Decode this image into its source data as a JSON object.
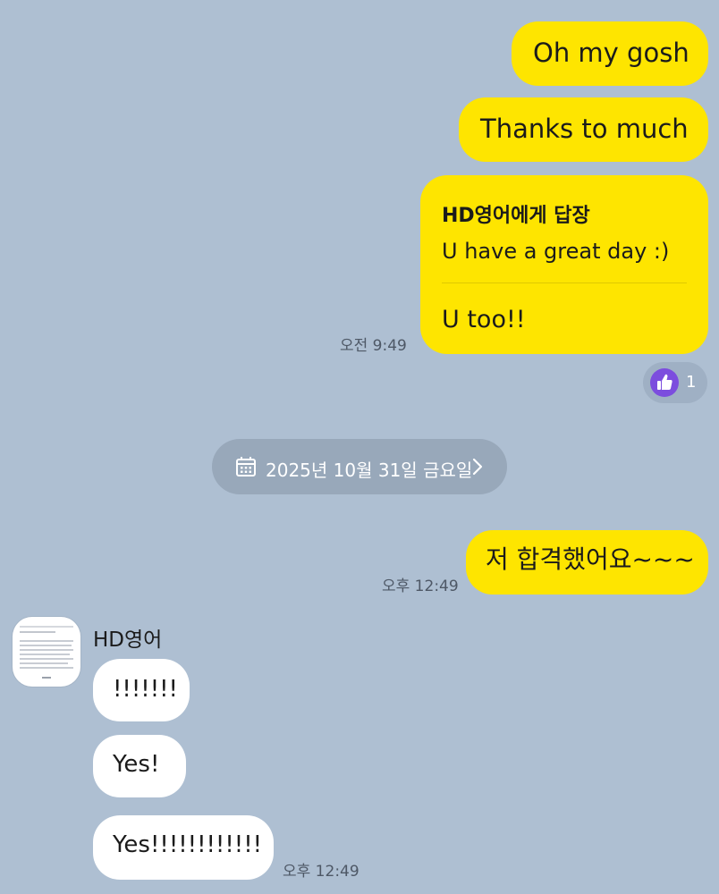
{
  "messages_out": [
    {
      "text": "Oh my gosh"
    },
    {
      "text": "Thanks to much"
    }
  ],
  "reply_message": {
    "header": "HD영어에게 답장",
    "quoted": "U have a great day :)",
    "body": "U too!!",
    "time": "오전 9:49",
    "reaction_count": "1"
  },
  "date_divider": {
    "label": "2025년 10월 31일 금요일"
  },
  "message_out_2": {
    "text": "저 합격했어요~~~",
    "time": "오후 12:49"
  },
  "incoming": {
    "sender": "HD영어",
    "messages": [
      {
        "text": "!!!!!!!"
      },
      {
        "text": "Yes!"
      },
      {
        "text": "Yes!!!!!!!!!!!!"
      }
    ],
    "time": "오후 12:49"
  },
  "colors": {
    "background": "#aebfd2",
    "my_bubble": "#fee500",
    "their_bubble": "#ffffff",
    "reaction_badge": "#7c4dde"
  },
  "icons": {
    "reaction": "thumbs-up-icon",
    "date": "calendar-icon",
    "date_link": "chevron-right-icon"
  }
}
